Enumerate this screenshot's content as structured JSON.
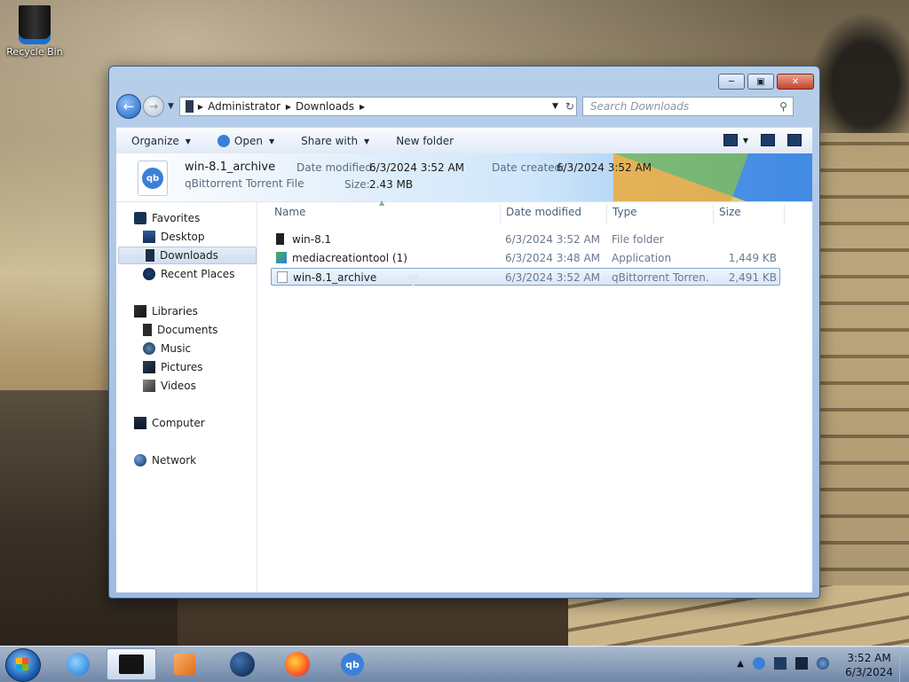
{
  "desktop": {
    "recycle_bin_label": "Recycle Bin"
  },
  "window": {
    "breadcrumb": [
      "Administrator",
      "Downloads"
    ],
    "search_placeholder": "Search Downloads",
    "toolbar": {
      "organize": "Organize",
      "open": "Open",
      "share_with": "Share with",
      "new_folder": "New folder"
    },
    "details": {
      "name": "win-8.1_archive",
      "type": "qBittorrent Torrent File",
      "date_modified_label": "Date modified:",
      "date_modified": "6/3/2024 3:52 AM",
      "date_created_label": "Date created:",
      "date_created": "6/3/2024 3:52 AM",
      "size_label": "Size:",
      "size": "2.43 MB",
      "icon_text": "qb"
    },
    "nav": {
      "favorites": "Favorites",
      "desktop": "Desktop",
      "downloads": "Downloads",
      "recent_places": "Recent Places",
      "libraries": "Libraries",
      "documents": "Documents",
      "music": "Music",
      "pictures": "Pictures",
      "videos": "Videos",
      "computer": "Computer",
      "network": "Network"
    },
    "columns": {
      "name": "Name",
      "date_modified": "Date modified",
      "type": "Type",
      "size": "Size"
    },
    "files": [
      {
        "name": "win-8.1",
        "date": "6/3/2024 3:52 AM",
        "type": "File folder",
        "size": ""
      },
      {
        "name": "mediacreationtool (1)",
        "date": "6/3/2024 3:48 AM",
        "type": "Application",
        "size": "1,449 KB"
      },
      {
        "name": "win-8.1_archive",
        "date": "6/3/2024 3:52 AM",
        "type": "qBittorrent Torren...",
        "size": "2,491 KB"
      }
    ]
  },
  "taskbar": {
    "qb_label": "qb",
    "time": "3:52 AM",
    "date": "6/3/2024"
  }
}
